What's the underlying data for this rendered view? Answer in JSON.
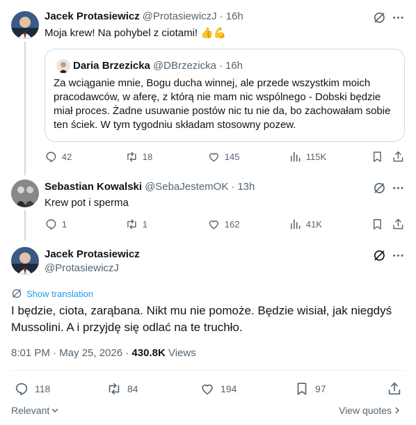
{
  "tweet1": {
    "name": "Jacek Protasiewicz",
    "handle": "@ProtasiewiczJ",
    "time": "16h",
    "text": "Moja krew! Na pohybel z ciotami! 👍💪",
    "quote": {
      "name": "Daria Brzezicka",
      "handle": "@DBrzezicka",
      "time": "16h",
      "text": "Za wciąganie mnie, Bogu ducha winnej,  ale przede wszystkim moich pracodawców, w aferę, z którą nie mam nic wspólnego - Dobski będzie miał proces. Żadne usuwanie postów nic tu nie da, bo zachowałam sobie ten ściek. W tym tygodniu składam stosowny pozew."
    },
    "replies": "42",
    "reposts": "18",
    "likes": "145",
    "views": "115K"
  },
  "tweet2": {
    "name": "Sebastian Kowalski",
    "handle": "@SebaJestemOK",
    "time": "13h",
    "text": "Krew pot i sperma",
    "replies": "1",
    "reposts": "1",
    "likes": "162",
    "views": "41K"
  },
  "main": {
    "name": "Jacek Protasiewicz",
    "handle": "@ProtasiewiczJ",
    "translate": "Show translation",
    "text": "I będzie, ciota, zarąbana. Nikt mu nie pomoże. Będzie wisiał, jak niegdyś Mussolini. A i przyjdę się odlać  na te truchło.",
    "date": "8:01 PM · May 25, 2026 · ",
    "views_count": "430.8K",
    "views_label": " Views",
    "replies": "118",
    "reposts": "84",
    "likes": "194",
    "bookmarks": "97",
    "relevant_label": "Relevant",
    "view_quotes_label": "View quotes"
  },
  "sep": " · ",
  "colors": {
    "text": "#0f1419",
    "muted": "#536471",
    "link": "#1d9bf0",
    "border": "#cfd9de"
  }
}
